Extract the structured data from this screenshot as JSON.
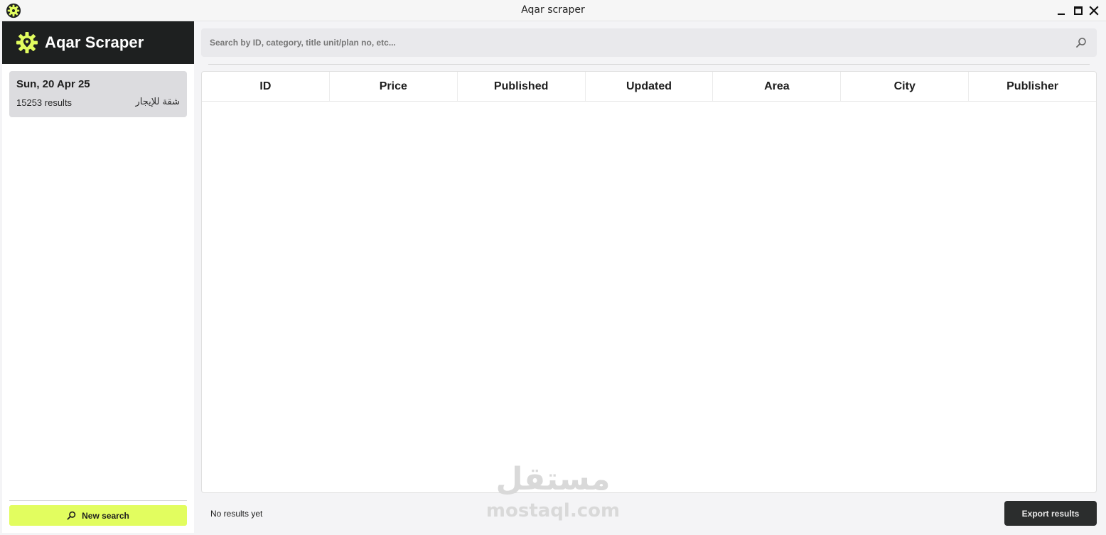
{
  "window": {
    "title": "Aqar scraper",
    "controls": {
      "minimize_icon": "minimize-icon",
      "maximize_icon": "maximize-icon",
      "close_icon": "close-icon"
    }
  },
  "sidebar": {
    "brand": {
      "name": "Aqar Scraper",
      "icon": "gear-location-icon",
      "accent": "#e2fd5f",
      "background": "#1e2020"
    },
    "history": [
      {
        "date": "Sun, 20 Apr 25",
        "results": "15253 results",
        "category": "شقة للإيجار"
      }
    ],
    "new_search_label": "New search"
  },
  "search": {
    "placeholder": "Search by ID, category, title unit/plan no, etc...",
    "value": ""
  },
  "table": {
    "columns": [
      "ID",
      "Price",
      "Published",
      "Updated",
      "Area",
      "City",
      "Publisher"
    ],
    "rows": []
  },
  "footer": {
    "status": "No results yet",
    "export_label": "Export results"
  },
  "watermark": {
    "arabic": "مستقل",
    "latin": "mostaql.com"
  }
}
